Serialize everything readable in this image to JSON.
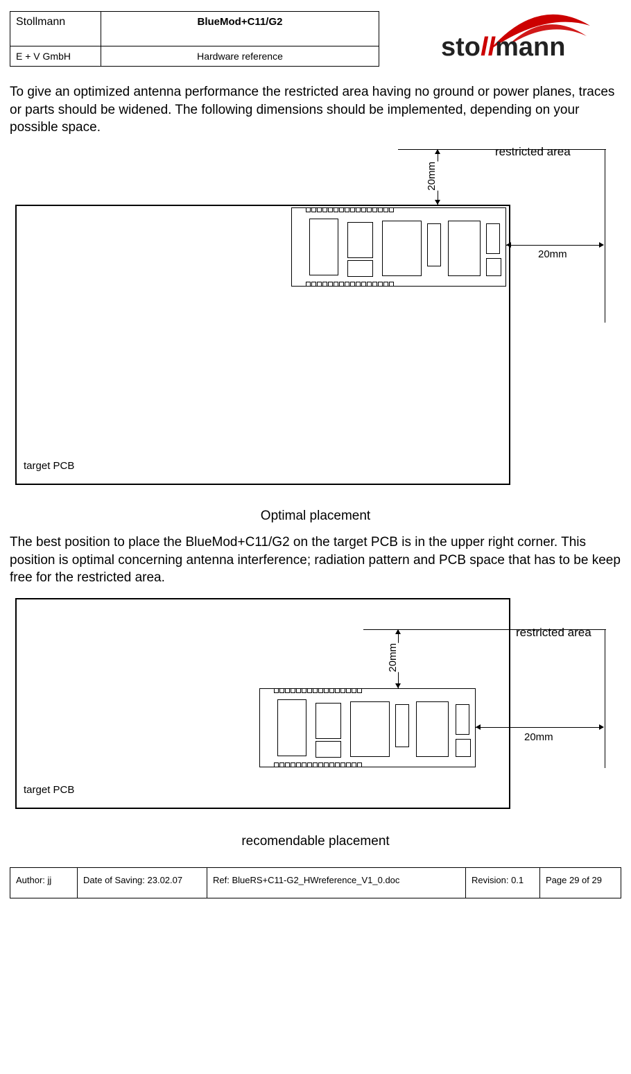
{
  "header": {
    "company": "Stollmann",
    "company_sub": "E + V GmbH",
    "product": "BlueMod+C11/G2",
    "doc_type": "Hardware reference",
    "logo_text": "sto//mann"
  },
  "paragraph1": "To give an optimized antenna performance the restricted area having no ground or power planes, traces or parts should be widened. The following dimensions should be implemented, depending on your possible space.",
  "figure1": {
    "restricted_label": "restricted area",
    "dim_top": "20mm",
    "dim_right": "20mm",
    "target_label": "target PCB"
  },
  "caption1": "Optimal placement",
  "paragraph2": "The best position to place the BlueMod+C11/G2 on the target PCB is in the upper right corner. This position is optimal concerning antenna interference; radiation pattern and PCB space that has to be keep free for the restricted area.",
  "figure2": {
    "restricted_label": "restricted area",
    "dim_top": "20mm",
    "dim_right": "20mm",
    "target_label": "target PCB"
  },
  "caption2": "recomendable placement",
  "footer": {
    "author": "Author: jj",
    "date": "Date of Saving: 23.02.07",
    "ref": "Ref: BlueRS+C11-G2_HWreference_V1_0.doc",
    "revision": "Revision: 0.1",
    "page": "Page 29 of 29"
  }
}
